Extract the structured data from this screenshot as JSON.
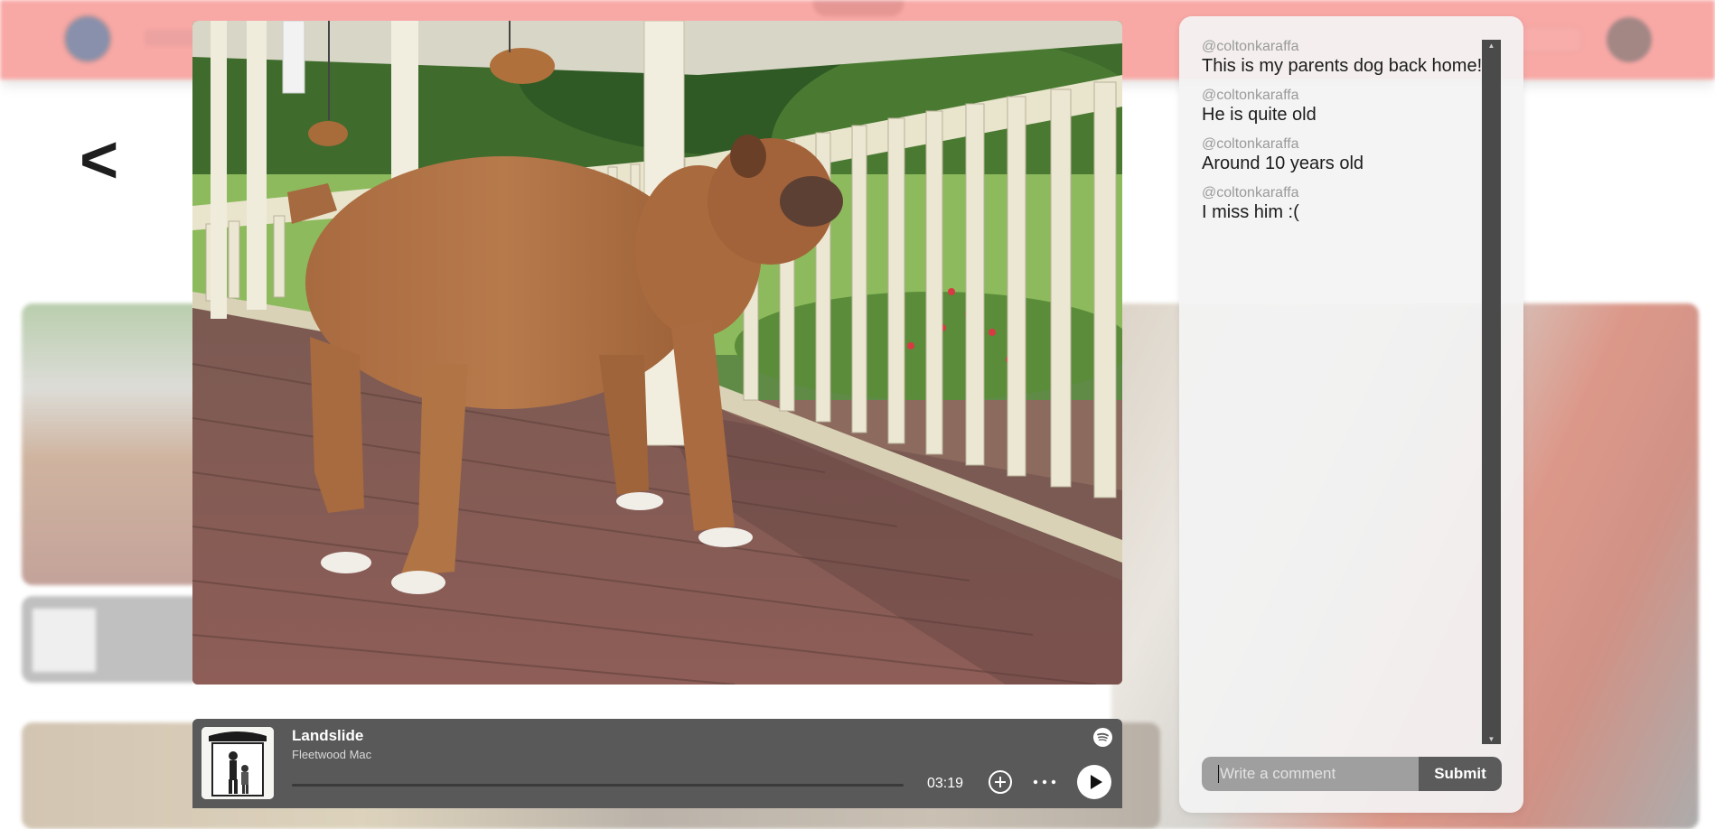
{
  "background": {
    "back_label": "<"
  },
  "player": {
    "track_title": "Landslide",
    "artist": "Fleetwood Mac",
    "time": "03:19",
    "progress": 0,
    "icons": {
      "spotify": "spotify-icon",
      "add": "add-circle-icon",
      "more": "ellipsis-icon",
      "play": "play-icon"
    }
  },
  "comments": [
    {
      "user": "@coltonkaraffa",
      "text": "This is my parents dog back home!"
    },
    {
      "user": "@coltonkaraffa",
      "text": "He is quite old"
    },
    {
      "user": "@coltonkaraffa",
      "text": "Around 10 years old"
    },
    {
      "user": "@coltonkaraffa",
      "text": "I miss him :("
    }
  ],
  "comment_form": {
    "placeholder": "Write a comment",
    "value": "",
    "submit_label": "Submit"
  },
  "colors": {
    "header": "#f4736f",
    "player": "#595959",
    "panel": "#f3f3f3",
    "input": "#9f9f9f",
    "submit": "#5b5b5b"
  }
}
